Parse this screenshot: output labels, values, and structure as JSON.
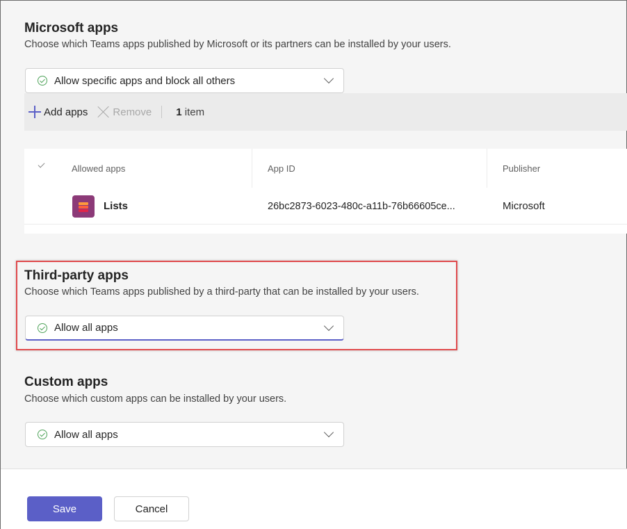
{
  "microsoft_apps": {
    "title": "Microsoft apps",
    "description": "Choose which Teams apps published by Microsoft or its partners can be installed by your users.",
    "selected": "Allow specific apps and block all others",
    "toolbar": {
      "add_label": "Add apps",
      "remove_label": "Remove",
      "count_number": "1",
      "count_unit": "item"
    },
    "table": {
      "columns": [
        "Allowed apps",
        "App ID",
        "Publisher"
      ],
      "rows": [
        {
          "name": "Lists",
          "app_id": "26bc2873-6023-480c-a11b-76b66605ce...",
          "publisher": "Microsoft",
          "icon": "lists-app-icon"
        }
      ]
    }
  },
  "third_party_apps": {
    "title": "Third-party apps",
    "description": "Choose which Teams apps published by a third-party that can be installed by your users.",
    "selected": "Allow all apps"
  },
  "custom_apps": {
    "title": "Custom apps",
    "description": "Choose which custom apps can be installed by your users.",
    "selected": "Allow all apps"
  },
  "footer": {
    "save_label": "Save",
    "cancel_label": "Cancel"
  },
  "colors": {
    "accent": "#5b5fc7",
    "highlight_border": "#e0494c",
    "check_green": "#4fa35a"
  }
}
